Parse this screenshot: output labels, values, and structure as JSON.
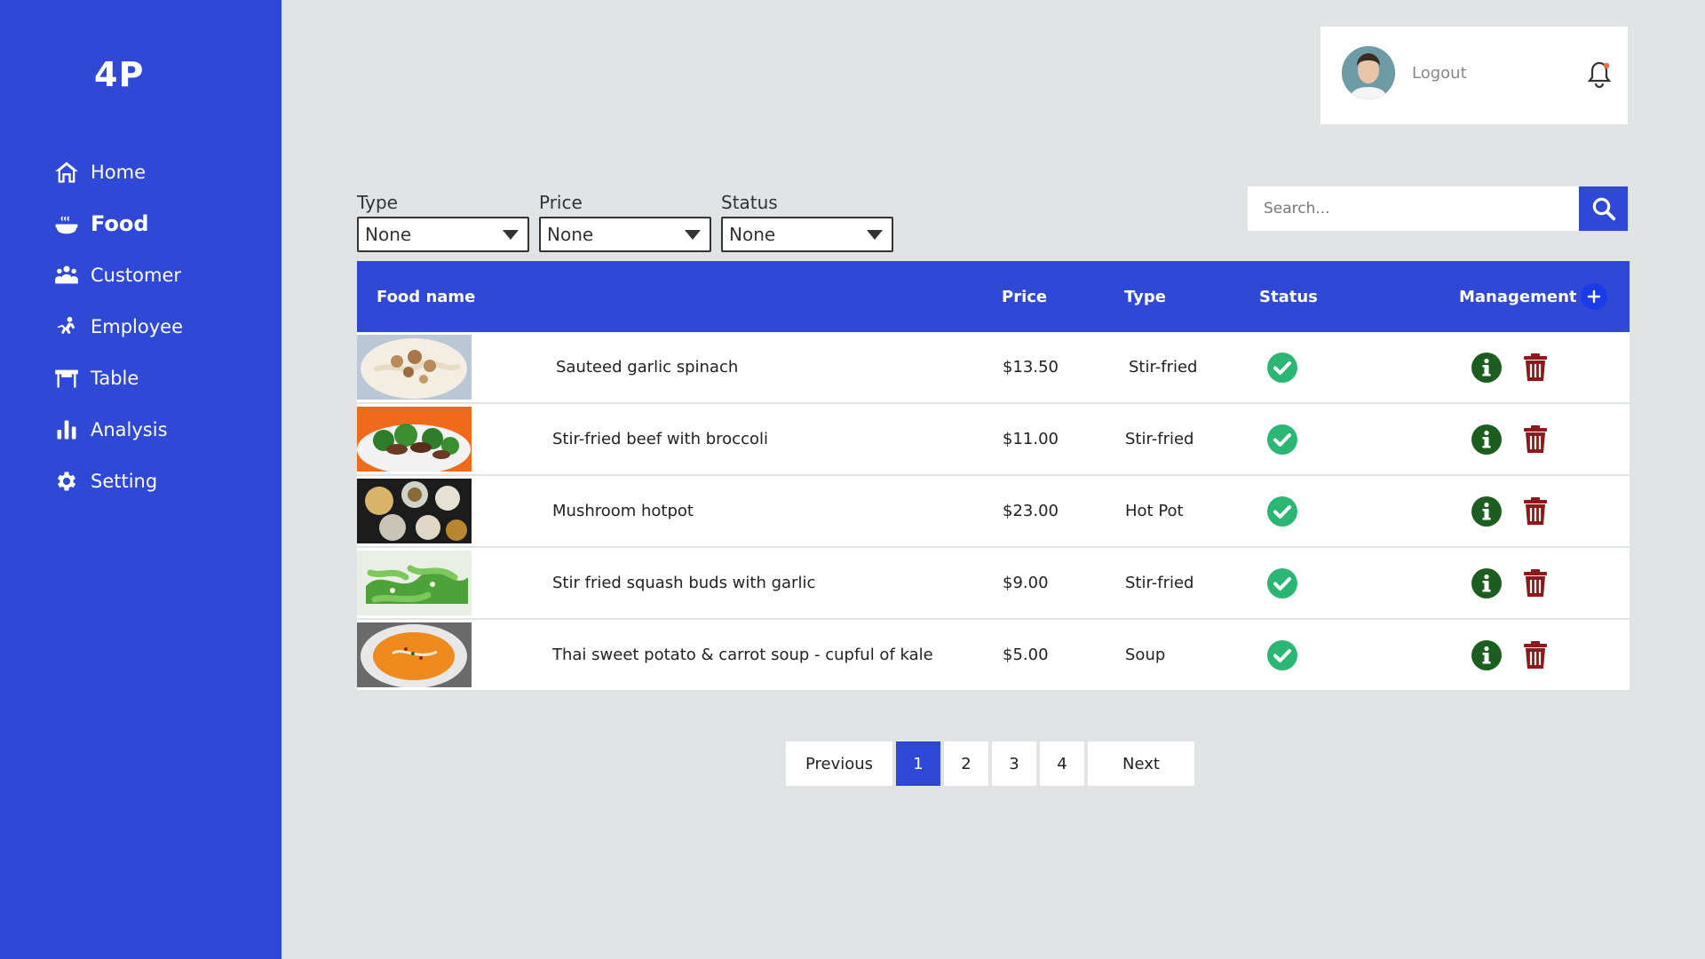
{
  "sidebar": {
    "logo": "4P",
    "items": [
      {
        "label": "Home",
        "icon": "home-icon"
      },
      {
        "label": "Food",
        "icon": "food-icon",
        "active": true
      },
      {
        "label": "Customer",
        "icon": "customer-icon"
      },
      {
        "label": "Employee",
        "icon": "employee-icon"
      },
      {
        "label": "Table",
        "icon": "table-icon"
      },
      {
        "label": "Analysis",
        "icon": "analysis-icon"
      },
      {
        "label": "Setting",
        "icon": "gear-icon"
      }
    ]
  },
  "header": {
    "logout_label": "Logout"
  },
  "filters": {
    "type": {
      "label": "Type",
      "value": "None"
    },
    "price": {
      "label": "Price",
      "value": "None"
    },
    "status": {
      "label": "Status",
      "value": "None"
    }
  },
  "search": {
    "placeholder": "Search..."
  },
  "table": {
    "columns": {
      "name": "Food name",
      "price": "Price",
      "type": "Type",
      "status": "Status",
      "management": "Management"
    },
    "rows": [
      {
        "name": "Sauteed garlic spinach",
        "price": "$13.50",
        "type": "Stir-fried",
        "status": "available"
      },
      {
        "name": "Stir-fried beef with broccoli",
        "price": "$11.00",
        "type": "Stir-fried",
        "status": "available"
      },
      {
        "name": "Mushroom hotpot",
        "price": "$23.00",
        "type": "Hot Pot",
        "status": "available"
      },
      {
        "name": "Stir fried squash buds with garlic",
        "price": "$9.00",
        "type": "Stir-fried",
        "status": "available"
      },
      {
        "name": "Thai sweet potato & carrot soup - cupful of kale",
        "price": "$5.00",
        "type": "Soup",
        "status": "available"
      }
    ]
  },
  "pagination": {
    "previous": "Previous",
    "pages": [
      "1",
      "2",
      "3",
      "4"
    ],
    "active_page": "1",
    "next": "Next"
  },
  "colors": {
    "primary": "#3048d6",
    "status_ok": "#2bb673",
    "info": "#1b5e20",
    "delete": "#8b1a1a"
  }
}
